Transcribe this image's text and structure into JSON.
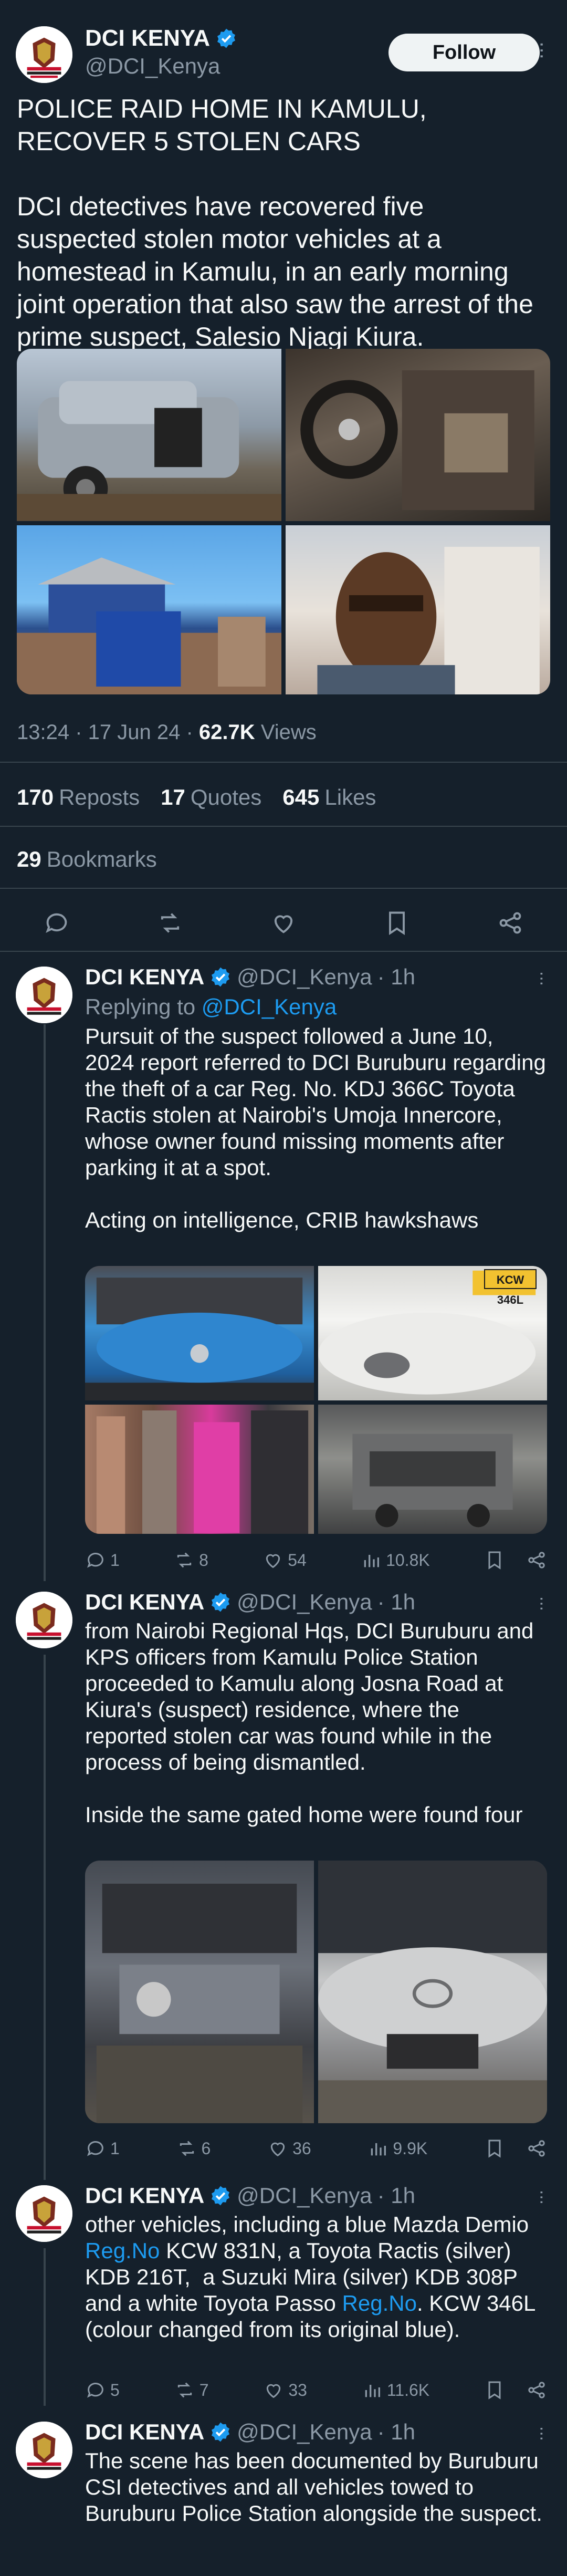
{
  "account": {
    "display_name": "DCI KENYA",
    "handle": "@DCI_Kenya",
    "verified_color": "#1d9bf0",
    "avatar_icon": "dci-badge-logo"
  },
  "main_tweet": {
    "follow_label": "Follow",
    "text": "POLICE RAID HOME IN KAMULU, RECOVER 5 STOLEN CARS\n\nDCI detectives have recovered five suspected stolen motor vehicles at a homestead in Kamulu, in an early morning joint operation that also saw the arrest of the prime suspect, Salesio Njagi Kiura.",
    "time": "13:24 · 17 Jun 24 · ",
    "views_count": "62.7K",
    "views_label": " Views",
    "reposts_count": "170",
    "reposts_label": "Reposts",
    "quotes_count": "17",
    "quotes_label": "Quotes",
    "likes_count": "645",
    "likes_label": "Likes",
    "bookmarks_count": "29",
    "bookmarks_label": "Bookmarks",
    "photos": [
      "damaged-silver-car-photo",
      "stripped-interior-photo",
      "blue-gated-house-photo",
      "suspect-selfie-photo"
    ]
  },
  "replies": [
    {
      "time": " · 1h",
      "replying_prefix": "Replying to ",
      "replying_to": "@DCI_Kenya",
      "text": "Pursuit of the suspect followed a June 10, 2024 report referred to DCI Buruburu regarding the theft of a car Reg. No. KDJ 366C Toyota Ractis stolen at Nairobi's Umoja Innercore, whose owner found missing moments after parking it at a spot.\n\nActing on intelligence, CRIB hawkshaws",
      "plate_label": "KCW 346L",
      "stats": {
        "replies": "1",
        "reposts": "8",
        "likes": "54",
        "views": "10.8K"
      }
    },
    {
      "time": " · 1h",
      "text": "from Nairobi Regional Hqs, DCI Buruburu and KPS officers from Kamulu Police Station proceeded to Kamulu along Josna Road at Kiura's (suspect) residence, where the reported stolen car was found while in the process of being dismantled.\n\nInside the same gated home were found four",
      "stats": {
        "replies": "1",
        "reposts": "6",
        "likes": "36",
        "views": "9.9K"
      }
    },
    {
      "time": " · 1h",
      "text_parts": [
        "other vehicles, including a blue Mazda Demio ",
        "Reg.No",
        " KCW 831N, a Toyota Ractis (silver) KDB 216T,  a Suzuki Mira (silver) KDB 308P and a white Toyota Passo ",
        "Reg.No",
        ". KCW 346L (colour changed from its original blue)."
      ],
      "stats": {
        "replies": "5",
        "reposts": "7",
        "likes": "33",
        "views": "11.6K"
      }
    },
    {
      "time": " · 1h",
      "text": "The scene has been documented by Buruburu CSI detectives and all vehicles towed to Buruburu Police Station alongside the suspect."
    }
  ]
}
